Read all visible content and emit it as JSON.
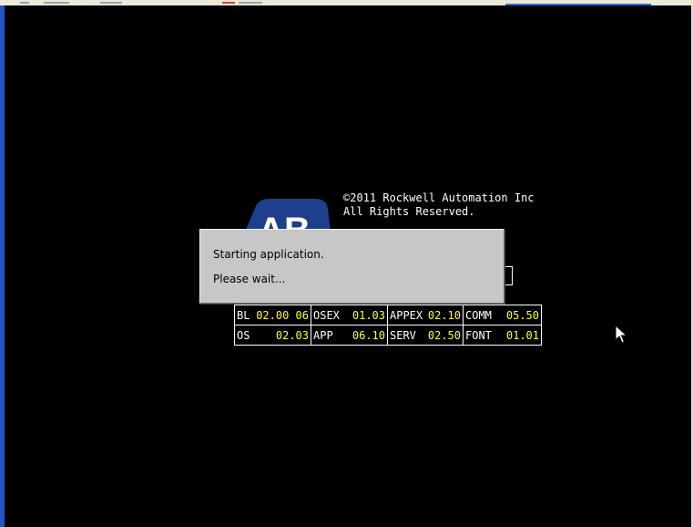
{
  "splash": {
    "copyright_line1": "©2011 Rockwell Automation Inc",
    "copyright_line2": "All Rights Reserved.",
    "logo_text": "AB"
  },
  "dialog": {
    "line1": "Starting application.",
    "line2": "Please wait..."
  },
  "versions": {
    "rows": [
      [
        {
          "label": "BL",
          "value": "02.00 06"
        },
        {
          "label": "OSEX",
          "value": "01.03"
        },
        {
          "label": "APPEX",
          "value": "02.10"
        },
        {
          "label": "COMM",
          "value": "05.50"
        }
      ],
      [
        {
          "label": "OS",
          "value": "02.03"
        },
        {
          "label": "APP",
          "value": "06.10"
        },
        {
          "label": "SERV",
          "value": "02.50"
        },
        {
          "label": "FONT",
          "value": "01.01"
        }
      ]
    ]
  },
  "colors": {
    "screen_background": "#000000",
    "label_text": "#ffffff",
    "version_value_text": "#ffff30",
    "logo_blue": "#1e3f8c",
    "dialog_background": "#c8c7c8",
    "window_border_blue": "#2356c6"
  },
  "icons": {
    "cursor": "mouse-pointer-icon",
    "logo": "allen-bradley-logo"
  }
}
